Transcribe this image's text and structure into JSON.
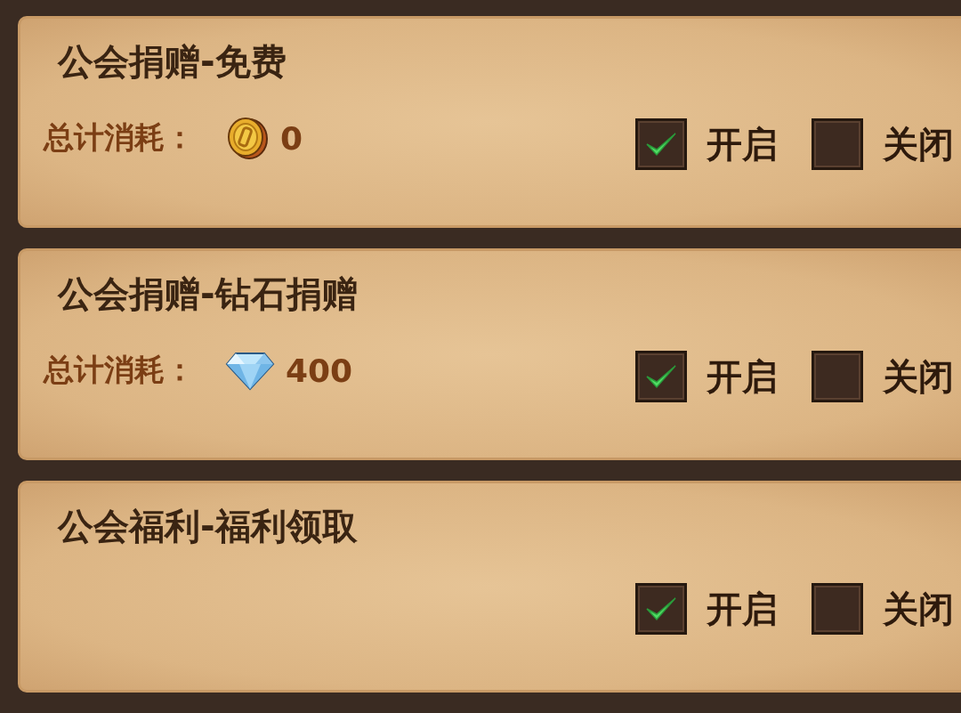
{
  "settings": [
    {
      "title": "公会捐赠-免费",
      "cost": {
        "label": "总计消耗：",
        "kind": "coin",
        "amount": "0"
      },
      "options": [
        {
          "label": "开启",
          "checked": true
        },
        {
          "label": "关闭",
          "checked": false
        }
      ]
    },
    {
      "title": "公会捐赠-钻石捐赠",
      "cost": {
        "label": "总计消耗：",
        "kind": "diamond",
        "amount": "400"
      },
      "options": [
        {
          "label": "开启",
          "checked": true
        },
        {
          "label": "关闭",
          "checked": false
        }
      ]
    },
    {
      "title": "公会福利-福利领取",
      "options": [
        {
          "label": "开启",
          "checked": true
        },
        {
          "label": "关闭",
          "checked": false
        }
      ]
    }
  ]
}
